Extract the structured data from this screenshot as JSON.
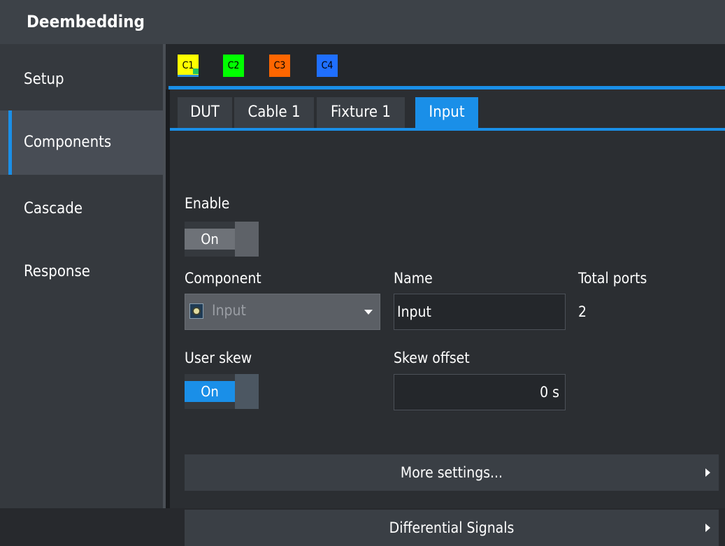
{
  "title": "Deembedding",
  "sidebar": {
    "items": [
      {
        "label": "Setup"
      },
      {
        "label": "Components"
      },
      {
        "label": "Cascade"
      },
      {
        "label": "Response"
      }
    ]
  },
  "channels": [
    {
      "label": "C1",
      "color": "#ffff00"
    },
    {
      "label": "C2",
      "color": "#00ff00"
    },
    {
      "label": "C3",
      "color": "#ff6600"
    },
    {
      "label": "C4",
      "color": "#1f6fff"
    }
  ],
  "subtabs": [
    {
      "label": "DUT"
    },
    {
      "label": "Cable 1"
    },
    {
      "label": "Fixture 1"
    },
    {
      "label": "Input"
    }
  ],
  "form": {
    "enable_label": "Enable",
    "enable_state": "On",
    "component_label": "Component",
    "component_value": "Input",
    "name_label": "Name",
    "name_value": "Input",
    "total_ports_label": "Total ports",
    "total_ports_value": "2",
    "user_skew_label": "User skew",
    "user_skew_state": "On",
    "skew_offset_label": "Skew offset",
    "skew_offset_value": "0 s"
  },
  "actions": {
    "more_settings": "More settings...",
    "differential_signals": "Differential Signals"
  }
}
